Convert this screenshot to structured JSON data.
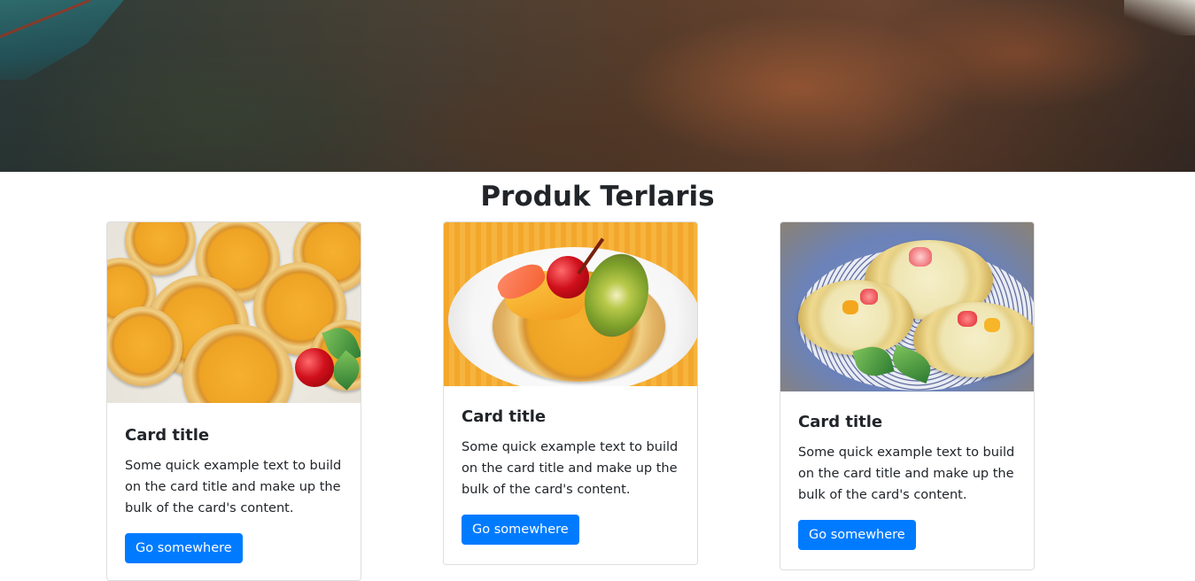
{
  "hero": {
    "icon": "landscape-photo"
  },
  "section": {
    "title": "Produk Terlaris"
  },
  "cards": [
    {
      "image_icon": "fruit-tart-photo",
      "title": "Card title",
      "text": "Some quick example text to build on the card title and make up the bulk of the card's content.",
      "button_label": "Go somewhere"
    },
    {
      "image_icon": "fruit-tart-photo",
      "title": "Card title",
      "text": "Some quick example text to build on the card title and make up the bulk of the card's content.",
      "button_label": "Go somewhere"
    },
    {
      "image_icon": "fruit-tart-photo",
      "title": "Card title",
      "text": "Some quick example text to build on the card title and make up the bulk of the card's content.",
      "button_label": "Go somewhere"
    }
  ],
  "colors": {
    "button": "#007bff",
    "text": "#212529",
    "card_border": "#dfdfdf"
  }
}
